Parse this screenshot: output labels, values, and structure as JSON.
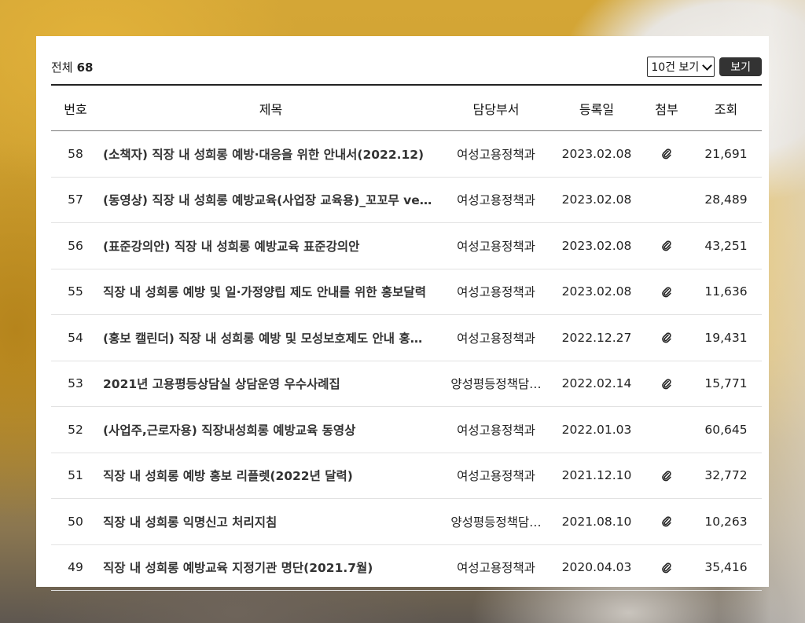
{
  "summary": {
    "total_label": "전체",
    "total_count": "68"
  },
  "controls": {
    "page_size_selected": "10건 보기",
    "view_button_label": "보기"
  },
  "table": {
    "columns": [
      "번호",
      "제목",
      "담당부서",
      "등록일",
      "첨부",
      "조회"
    ],
    "rows": [
      {
        "no": "58",
        "title": "(소책자) 직장 내 성희롱 예방·대응을 위한 안내서(2022.12)",
        "dept": "여성고용정책과",
        "date": "2023.02.08",
        "attachment": true,
        "views": "21,691"
      },
      {
        "no": "57",
        "title": "(동영상) 직장 내 성희롱 예방교육(사업장 교육용)_꼬꼬무 ve…",
        "dept": "여성고용정책과",
        "date": "2023.02.08",
        "attachment": false,
        "views": "28,489"
      },
      {
        "no": "56",
        "title": "(표준강의안) 직장 내 성희롱 예방교육 표준강의안",
        "dept": "여성고용정책과",
        "date": "2023.02.08",
        "attachment": true,
        "views": "43,251"
      },
      {
        "no": "55",
        "title": "직장 내 성희롱 예방 및 일·가정양립 제도 안내를 위한 홍보달력",
        "dept": "여성고용정책과",
        "date": "2023.02.08",
        "attachment": true,
        "views": "11,636"
      },
      {
        "no": "54",
        "title": "(홍보 캘린더) 직장 내 성희롱 예방 및 모성보호제도 안내 홍…",
        "dept": "여성고용정책과",
        "date": "2022.12.27",
        "attachment": true,
        "views": "19,431"
      },
      {
        "no": "53",
        "title": "2021년 고용평등상담실 상담운영 우수사례집",
        "dept": "양성평등정책담…",
        "date": "2022.02.14",
        "attachment": true,
        "views": "15,771"
      },
      {
        "no": "52",
        "title": "(사업주,근로자용) 직장내성희롱 예방교육 동영상",
        "dept": "여성고용정책과",
        "date": "2022.01.03",
        "attachment": false,
        "views": "60,645"
      },
      {
        "no": "51",
        "title": "직장 내 성희롱 예방 홍보 리플렛(2022년 달력)",
        "dept": "여성고용정책과",
        "date": "2021.12.10",
        "attachment": true,
        "views": "32,772"
      },
      {
        "no": "50",
        "title": "직장 내 성희롱 익명신고 처리지침",
        "dept": "양성평등정책담…",
        "date": "2021.08.10",
        "attachment": true,
        "views": "10,263"
      },
      {
        "no": "49",
        "title": "직장 내 성희롱 예방교육 지정기관 명단(2021.7월)",
        "dept": "여성고용정책과",
        "date": "2020.04.03",
        "attachment": true,
        "views": "35,416"
      }
    ]
  },
  "icons": {
    "attachment": "paperclip-icon",
    "dropdown": "chevron-down-icon"
  },
  "colors": {
    "button_bg": "#333333",
    "header_rule": "#222222",
    "row_rule": "#e2e2e2"
  }
}
